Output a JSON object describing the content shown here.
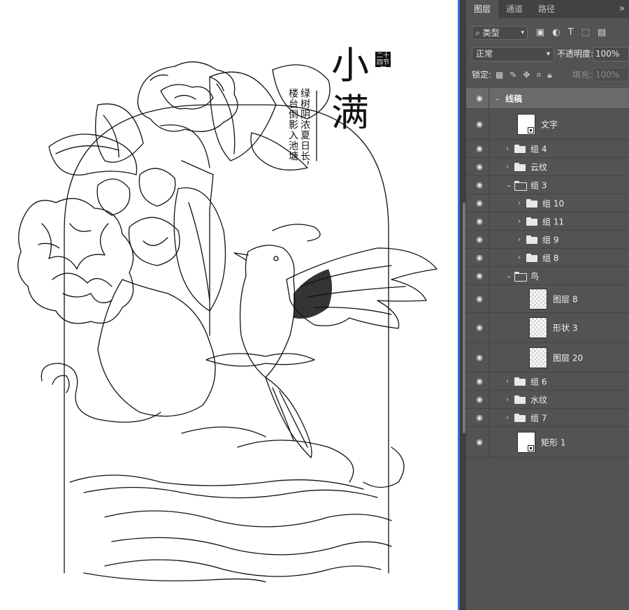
{
  "artwork": {
    "title_chars": [
      "小",
      "满"
    ],
    "seal_text": "二十四节气",
    "poem_col_1": "绿树阴浓夏日长，",
    "poem_col_2": "楼台倒影入池塘"
  },
  "panel": {
    "tabs": [
      {
        "label": "图层",
        "active": true
      },
      {
        "label": "通道",
        "active": false
      },
      {
        "label": "路径",
        "active": false
      }
    ],
    "tabs_more": "»",
    "filter": {
      "label": "类型",
      "icons": [
        "image-filter-icon",
        "adjustment-filter-icon",
        "type-filter-icon",
        "shape-filter-icon",
        "smart-object-filter-icon"
      ]
    },
    "blend_mode": "正常",
    "opacity_label": "不透明度:",
    "opacity_value": "100%",
    "lock_label": "锁定:",
    "fill_label": "填充:",
    "fill_value": "100%"
  },
  "layers": [
    {
      "name": "线稿",
      "type": "group",
      "expanded": true,
      "depth": 0,
      "height": 30,
      "selected": true
    },
    {
      "name": "文字",
      "type": "layer",
      "depth": 1,
      "height": 44,
      "thumb": "solid-badge"
    },
    {
      "name": "组 4",
      "type": "group",
      "expanded": false,
      "depth": 1,
      "height": 26
    },
    {
      "name": "云纹",
      "type": "group",
      "expanded": false,
      "depth": 1,
      "height": 26
    },
    {
      "name": "组 3",
      "type": "group",
      "expanded": true,
      "depth": 1,
      "height": 26
    },
    {
      "name": "组 10",
      "type": "group",
      "expanded": false,
      "depth": 2,
      "height": 26
    },
    {
      "name": "组 11",
      "type": "group",
      "expanded": false,
      "depth": 2,
      "height": 26
    },
    {
      "name": "组 9",
      "type": "group",
      "expanded": false,
      "depth": 2,
      "height": 26
    },
    {
      "name": "组 8",
      "type": "group",
      "expanded": false,
      "depth": 2,
      "height": 26
    },
    {
      "name": "鸟",
      "type": "group",
      "expanded": true,
      "depth": 1,
      "height": 26
    },
    {
      "name": "图层 8",
      "type": "layer",
      "depth": 2,
      "height": 40,
      "thumb": "checker"
    },
    {
      "name": "形状 3",
      "type": "layer",
      "depth": 2,
      "height": 43,
      "thumb": "checker"
    },
    {
      "name": "图层 20",
      "type": "layer",
      "depth": 2,
      "height": 42,
      "thumb": "checker"
    },
    {
      "name": "组 6",
      "type": "group",
      "expanded": false,
      "depth": 1,
      "height": 26
    },
    {
      "name": "水纹",
      "type": "group",
      "expanded": false,
      "depth": 1,
      "height": 26
    },
    {
      "name": "组 7",
      "type": "group",
      "expanded": false,
      "depth": 1,
      "height": 26
    },
    {
      "name": "矩形 1",
      "type": "layer",
      "depth": 1,
      "height": 44,
      "thumb": "solid-badge"
    }
  ]
}
